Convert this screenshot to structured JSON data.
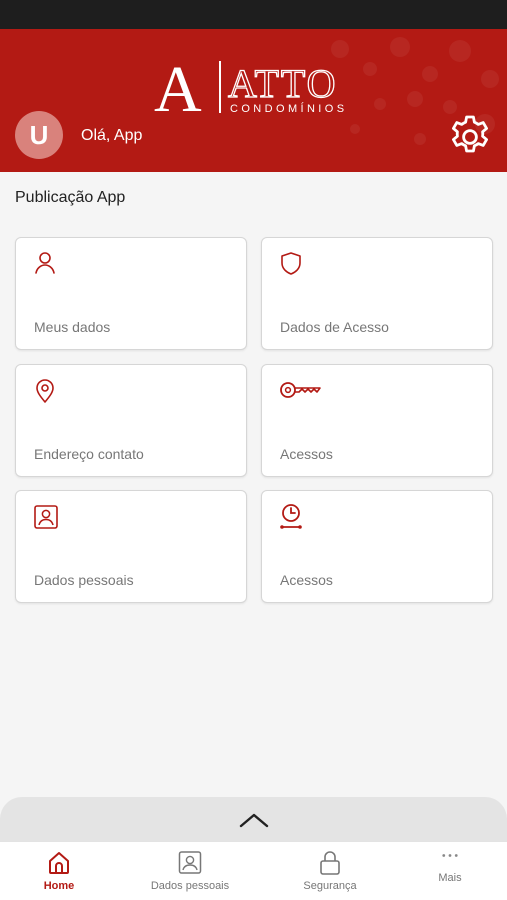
{
  "header": {
    "logo_letter": "A",
    "logo_brand": "ATTO",
    "logo_sub": "CONDOMÍNIOS",
    "avatar_initial": "U",
    "greeting": "Olá, App",
    "settings_icon": "gear-icon"
  },
  "section_title": "Publicação App",
  "cards": [
    {
      "label": "Meus dados",
      "icon": "user-icon"
    },
    {
      "label": "Dados de Acesso",
      "icon": "shield-icon"
    },
    {
      "label": "Endereço contato",
      "icon": "location-pin-icon"
    },
    {
      "label": "Acessos",
      "icon": "key-icon"
    },
    {
      "label": "Dados pessoais",
      "icon": "id-card-icon"
    },
    {
      "label": "Acessos",
      "icon": "clock-icon"
    }
  ],
  "drawer": {
    "icon": "chevron-up-icon"
  },
  "bottom_nav": [
    {
      "label": "Home",
      "icon": "home-icon",
      "active": true
    },
    {
      "label": "Dados pessoais",
      "icon": "id-card-icon",
      "active": false
    },
    {
      "label": "Segurança",
      "icon": "lock-icon",
      "active": false
    },
    {
      "label": "Mais",
      "icon": "more-dots-icon",
      "active": false
    }
  ],
  "colors": {
    "brand": "#b31a14",
    "background": "#f5f5f5",
    "avatar": "#d9827c"
  }
}
